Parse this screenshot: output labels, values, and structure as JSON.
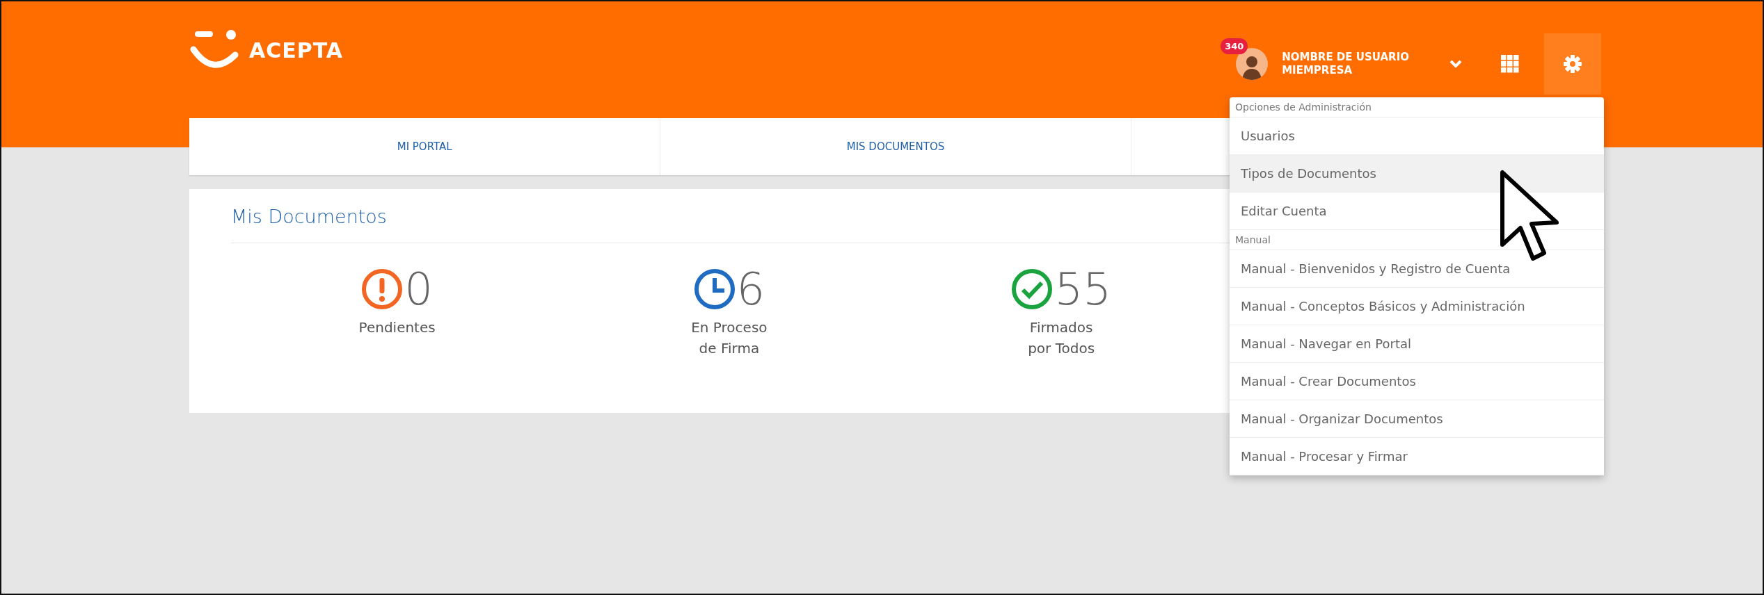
{
  "brand": {
    "name": "ACEPTA"
  },
  "user": {
    "badge": "340",
    "name": "NOMBRE DE USUARIO",
    "company": "MIEMPRESA"
  },
  "nav": {
    "tabs": [
      {
        "label": "MI PORTAL",
        "selected": false
      },
      {
        "label": "MIS DOCUMENTOS",
        "selected": false
      },
      {
        "selected": false
      }
    ]
  },
  "card": {
    "title": "Mis Documentos",
    "stats": [
      {
        "kind": "pending",
        "count": "0",
        "label": "Pendientes",
        "color": "#f26522"
      },
      {
        "kind": "in_progress",
        "count": "6",
        "label": "En Proceso de Firma",
        "color": "#1e6bc1"
      },
      {
        "kind": "signed",
        "count": "55",
        "label": "Firmados por Todos",
        "color": "#1aa33f"
      }
    ]
  },
  "menu": {
    "items": [
      {
        "kind": "header",
        "label": "Opciones de Administración"
      },
      {
        "kind": "item",
        "label": "Usuarios",
        "highlighted": false
      },
      {
        "kind": "item",
        "label": "Tipos de Documentos",
        "highlighted": true
      },
      {
        "kind": "item",
        "label": "Editar Cuenta",
        "highlighted": false
      },
      {
        "kind": "header",
        "label": "Manual"
      },
      {
        "kind": "item",
        "label": "Manual - Bienvenidos y Registro de Cuenta",
        "highlighted": false
      },
      {
        "kind": "item",
        "label": "Manual - Conceptos Básicos y Administración",
        "highlighted": false
      },
      {
        "kind": "item",
        "label": "Manual - Navegar en Portal",
        "highlighted": false
      },
      {
        "kind": "item",
        "label": "Manual - Crear Documentos",
        "highlighted": false
      },
      {
        "kind": "item",
        "label": "Manual - Organizar Documentos",
        "highlighted": false
      },
      {
        "kind": "item",
        "label": "Manual - Procesar y Firmar",
        "highlighted": false
      }
    ]
  }
}
